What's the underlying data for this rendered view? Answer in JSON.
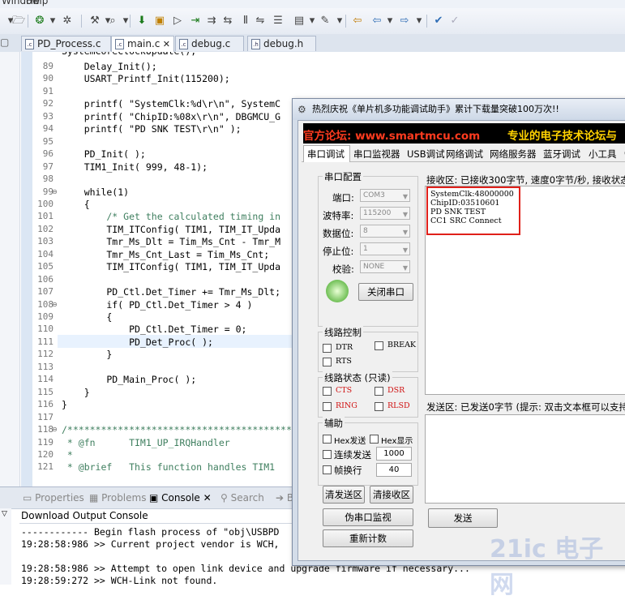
{
  "menu": {
    "items": [
      "Window",
      "Help"
    ]
  },
  "editor_tabs": [
    {
      "label": "PD_Process.c",
      "icon": "c-file-icon",
      "closable": false
    },
    {
      "label": "main.c",
      "icon": "c-file-icon",
      "closable": true,
      "active": true
    },
    {
      "label": "debug.c",
      "icon": "c-file-icon",
      "closable": false
    },
    {
      "label": "debug.h",
      "icon": "h-file-icon",
      "closable": false
    }
  ],
  "code_lines": [
    {
      "n": "89",
      "text": "    Delay_Init();"
    },
    {
      "n": "90",
      "text": "    USART_Printf_Init(115200);"
    },
    {
      "n": "91",
      "text": ""
    },
    {
      "n": "92",
      "text": "    printf( \"SystemClk:%d\\r\\n\", SystemC"
    },
    {
      "n": "93",
      "text": "    printf( \"ChipID:%08x\\r\\n\", DBGMCU_G"
    },
    {
      "n": "94",
      "text": "    printf( \"PD SNK TEST\\r\\n\" );"
    },
    {
      "n": "95",
      "text": ""
    },
    {
      "n": "96",
      "text": "    PD_Init( );"
    },
    {
      "n": "97",
      "text": "    TIM1_Init( 999, 48-1);"
    },
    {
      "n": "98",
      "text": ""
    },
    {
      "n": "99",
      "text": "    while(1)"
    },
    {
      "n": "100",
      "text": "    {"
    },
    {
      "n": "101",
      "text": "        /* Get the calculated timing in"
    },
    {
      "n": "102",
      "text": "        TIM_ITConfig( TIM1, TIM_IT_Upda"
    },
    {
      "n": "103",
      "text": "        Tmr_Ms_Dlt = Tim_Ms_Cnt - Tmr_M"
    },
    {
      "n": "104",
      "text": "        Tmr_Ms_Cnt_Last = Tim_Ms_Cnt;"
    },
    {
      "n": "105",
      "text": "        TIM_ITConfig( TIM1, TIM_IT_Upda"
    },
    {
      "n": "106",
      "text": ""
    },
    {
      "n": "107",
      "text": "        PD_Ctl.Det_Timer += Tmr_Ms_Dlt;"
    },
    {
      "n": "108",
      "text": "        if( PD_Ctl.Det_Timer > 4 )"
    },
    {
      "n": "109",
      "text": "        {"
    },
    {
      "n": "110",
      "text": "            PD_Ctl.Det_Timer = 0;"
    },
    {
      "n": "111",
      "text": "            PD_Det_Proc( );"
    },
    {
      "n": "112",
      "text": "        }"
    },
    {
      "n": "113",
      "text": ""
    },
    {
      "n": "114",
      "text": "        PD_Main_Proc( );"
    },
    {
      "n": "115",
      "text": "    }"
    },
    {
      "n": "116",
      "text": "}"
    },
    {
      "n": "117",
      "text": ""
    },
    {
      "n": "118",
      "text": "/********************************************"
    },
    {
      "n": "119",
      "text": " * @fn      TIM1_UP_IRQHandler"
    },
    {
      "n": "120",
      "text": " *"
    },
    {
      "n": "121",
      "text": " * @brief   This function handles TIM1"
    }
  ],
  "console": {
    "tabs": [
      "Properties",
      "Problems",
      "Console",
      "Search"
    ],
    "title": "Download Output Console",
    "lines": [
      "------------ Begin flash process of \"obj\\USBPD",
      "19:28:58:986 >> Current project vendor is WCH,",
      "",
      "19:28:58:986 >> Attempt to open link device and upgrade firmware if necessary...",
      "19:28:59:272 >> WCH-Link not found."
    ]
  },
  "serial_tool": {
    "title": "热烈庆祝《单片机多功能调试助手》累计下载量突破100万次!!",
    "banner_left": "官方论坛: www.smartmcu.com",
    "banner_right": "专业的电子技术论坛与",
    "tabs": [
      "串口调试",
      "串口监视器",
      "USB调试",
      "网络调试",
      "网络服务器",
      "蓝牙调试",
      "小工具",
      "C"
    ],
    "config_title": "串口配置",
    "port_label": "端口:",
    "port_value": "COM3",
    "baud_label": "波特率:",
    "baud_value": "115200",
    "data_label": "数据位:",
    "data_value": "8",
    "stop_label": "停止位:",
    "stop_value": "1",
    "parity_label": "校验:",
    "parity_value": "NONE",
    "close_port": "关闭串口",
    "line_ctrl_title": "线路控制",
    "dtr": "DTR",
    "break": "BREAK",
    "rts": "RTS",
    "line_status_title": "线路状态 (只读)",
    "cts": "CTS",
    "dsr": "DSR",
    "ring": "RING",
    "rlsd": "RLSD",
    "aux_title": "辅助",
    "hex_send": "Hex发送",
    "hex_show": "Hex显示",
    "cont_send": "连续发送",
    "cont_value": "1000",
    "frame_newline": "帧换行",
    "frame_value": "40",
    "clear_send": "清发送区",
    "clear_recv": "清接收区",
    "fake_monitor": "伪串口监视",
    "recount": "重新计数",
    "recv_header": "接收区: 已接收300字节, 速度0字节/秒, 接收状态",
    "recv_lines": [
      "SystemClk:48000000",
      "ChipID:03510601",
      "PD SNK TEST",
      "CC1 SRC Connect"
    ],
    "send_header": "发送区: 已发送0字节 (提示: 双击文本框可以支持",
    "send_button": "发送"
  },
  "watermark": "21ic 电子网",
  "colors": {
    "accent": "#2f6db5",
    "highlight_box": "#e0201a",
    "banner_left": "#ff3b1f",
    "banner_right": "#ffd200"
  }
}
